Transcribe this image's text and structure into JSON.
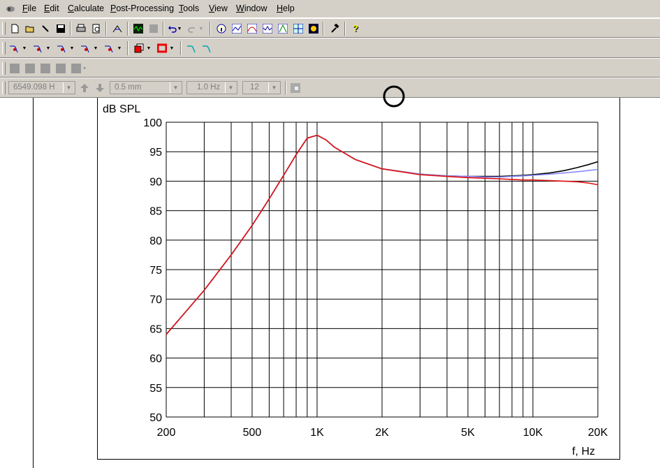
{
  "menu": {
    "items": [
      {
        "label": "File"
      },
      {
        "label": "Edit"
      },
      {
        "label": "Calculate"
      },
      {
        "label": "Post-Processing"
      },
      {
        "label": "Tools"
      },
      {
        "label": "View"
      },
      {
        "label": "Window"
      },
      {
        "label": "Help"
      }
    ]
  },
  "toolbar4": {
    "frequency_value": "6549.098 H",
    "distance_value": "0.5 mm",
    "step_value": "1.0 Hz",
    "count_value": "12"
  },
  "colors": {
    "series_black": "#000000",
    "series_blue": "#8a8aff",
    "series_red": "#e01010",
    "grid": "#000000"
  },
  "chart_data": {
    "type": "line",
    "ylabel": "dB SPL",
    "xlabel": "f, Hz",
    "x_scale": "log",
    "xlim": [
      200,
      20000
    ],
    "ylim": [
      50,
      100
    ],
    "grid": true,
    "x_tick_labels": [
      {
        "value": 200,
        "label": "200"
      },
      {
        "value": 500,
        "label": "500"
      },
      {
        "value": 1000,
        "label": "1K"
      },
      {
        "value": 2000,
        "label": "2K"
      },
      {
        "value": 5000,
        "label": "5K"
      },
      {
        "value": 10000,
        "label": "10K"
      },
      {
        "value": 20000,
        "label": "20K"
      }
    ],
    "x_gridlines": [
      200,
      300,
      400,
      500,
      600,
      700,
      800,
      900,
      1000,
      2000,
      3000,
      4000,
      5000,
      6000,
      7000,
      8000,
      9000,
      10000,
      20000
    ],
    "y_ticks": [
      50,
      55,
      60,
      65,
      70,
      75,
      80,
      85,
      90,
      95,
      100
    ],
    "series": [
      {
        "color": "#000000",
        "x": [
          200,
          300,
          400,
          500,
          600,
          700,
          800,
          900,
          1000,
          1100,
          1200,
          1500,
          2000,
          3000,
          4000,
          5000,
          6000,
          7000,
          8000,
          9000,
          10000,
          12000,
          14000,
          16000,
          18000,
          20000
        ],
        "y": [
          64,
          71.5,
          77.5,
          82.5,
          87,
          91,
          94.5,
          97.3,
          97.8,
          97,
          95.8,
          93.7,
          92.1,
          91.2,
          90.9,
          90.8,
          90.8,
          90.8,
          90.9,
          91,
          91.1,
          91.4,
          91.8,
          92.3,
          92.8,
          93.3
        ]
      },
      {
        "color": "#8a8aff",
        "x": [
          200,
          300,
          400,
          500,
          600,
          700,
          800,
          900,
          1000,
          1100,
          1200,
          1500,
          2000,
          3000,
          4000,
          5000,
          6000,
          7000,
          8000,
          9000,
          10000,
          12000,
          14000,
          16000,
          18000,
          20000
        ],
        "y": [
          64,
          71.5,
          77.5,
          82.5,
          87,
          91,
          94.5,
          97.3,
          97.8,
          97,
          95.8,
          93.7,
          92.1,
          91.2,
          90.9,
          90.8,
          90.7,
          90.7,
          90.8,
          90.9,
          91,
          91.2,
          91.4,
          91.6,
          91.8,
          92
        ]
      },
      {
        "color": "#e01010",
        "x": [
          200,
          300,
          400,
          500,
          600,
          700,
          800,
          900,
          1000,
          1100,
          1200,
          1500,
          2000,
          3000,
          4000,
          5000,
          6000,
          7000,
          8000,
          9000,
          10000,
          12000,
          14000,
          16000,
          18000,
          20000
        ],
        "y": [
          64,
          71.5,
          77.5,
          82.5,
          87,
          91,
          94.5,
          97.3,
          97.8,
          97,
          95.8,
          93.7,
          92.1,
          91.1,
          90.8,
          90.6,
          90.5,
          90.4,
          90.3,
          90.2,
          90.2,
          90.1,
          90,
          89.9,
          89.7,
          89.4
        ]
      }
    ]
  }
}
